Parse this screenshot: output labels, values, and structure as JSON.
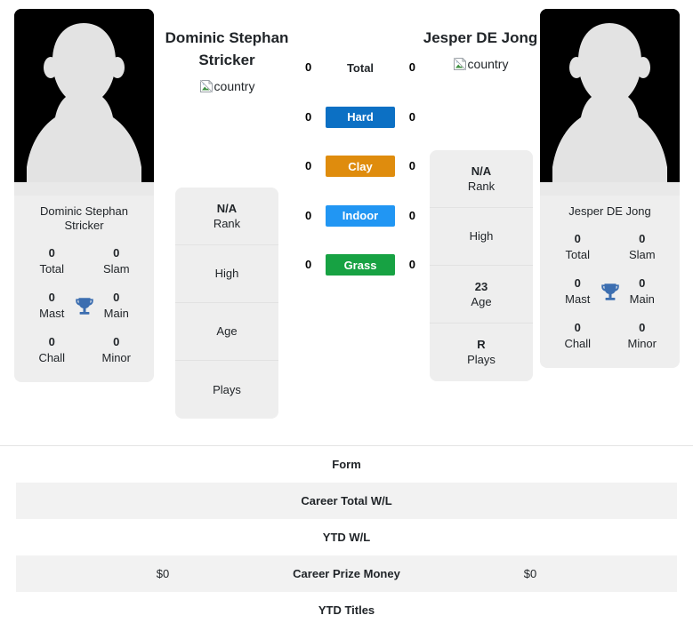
{
  "players": {
    "left": {
      "name": "Dominic Stephan Stricker",
      "card_name": "Dominic Stephan Stricker",
      "flag_alt": "country",
      "avatar_alt": "player-photo",
      "info": [
        {
          "value": "N/A",
          "label": "Rank"
        },
        {
          "value": "",
          "label": "High"
        },
        {
          "value": "",
          "label": "Age"
        },
        {
          "value": "",
          "label": "Plays"
        }
      ],
      "titles": [
        {
          "value": "0",
          "label": "Total"
        },
        {
          "value": "0",
          "label": "Slam"
        },
        {
          "value": "0",
          "label": "Mast"
        },
        {
          "value": "0",
          "label": "Main"
        },
        {
          "value": "0",
          "label": "Chall"
        },
        {
          "value": "0",
          "label": "Minor"
        }
      ]
    },
    "right": {
      "name": "Jesper DE Jong",
      "card_name": "Jesper DE Jong",
      "flag_alt": "country",
      "avatar_alt": "player-photo",
      "info": [
        {
          "value": "N/A",
          "label": "Rank"
        },
        {
          "value": "",
          "label": "High"
        },
        {
          "value": "23",
          "label": "Age"
        },
        {
          "value": "R",
          "label": "Plays"
        }
      ],
      "titles": [
        {
          "value": "0",
          "label": "Total"
        },
        {
          "value": "0",
          "label": "Slam"
        },
        {
          "value": "0",
          "label": "Mast"
        },
        {
          "value": "0",
          "label": "Main"
        },
        {
          "value": "0",
          "label": "Chall"
        },
        {
          "value": "0",
          "label": "Minor"
        }
      ]
    }
  },
  "surfaces": [
    {
      "label": "Total",
      "left": "0",
      "right": "0",
      "color": "",
      "plain": true
    },
    {
      "label": "Hard",
      "left": "0",
      "right": "0",
      "color": "#0c70c4",
      "plain": false
    },
    {
      "label": "Clay",
      "left": "0",
      "right": "0",
      "color": "#df8c0d",
      "plain": false
    },
    {
      "label": "Indoor",
      "left": "0",
      "right": "0",
      "color": "#2196f3",
      "plain": false
    },
    {
      "label": "Grass",
      "left": "0",
      "right": "0",
      "color": "#17a243",
      "plain": false
    }
  ],
  "stat_rows": [
    {
      "label": "Form",
      "left": "",
      "right": "",
      "alt": false
    },
    {
      "label": "Career Total W/L",
      "left": "",
      "right": "",
      "alt": true
    },
    {
      "label": "YTD W/L",
      "left": "",
      "right": "",
      "alt": false
    },
    {
      "label": "Career Prize Money",
      "left": "$0",
      "right": "$0",
      "alt": true
    },
    {
      "label": "YTD Titles",
      "left": "",
      "right": "",
      "alt": false
    }
  ],
  "icons": {
    "trophy": "trophy-icon",
    "broken_image": "broken-image-icon"
  },
  "colors": {
    "hard": "#0c70c4",
    "clay": "#df8c0d",
    "indoor": "#2196f3",
    "grass": "#17a243",
    "trophy": "#3c6eb0",
    "card_bg": "#eeeeee",
    "row_alt_bg": "#f2f2f2"
  }
}
